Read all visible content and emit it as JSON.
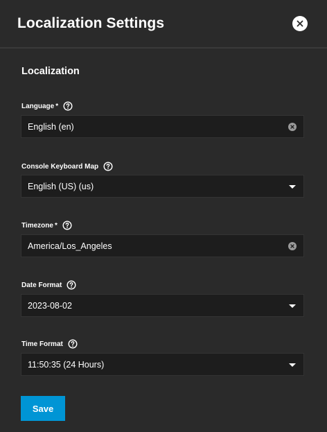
{
  "dialog": {
    "title": "Localization Settings",
    "close_icon": "close-icon"
  },
  "section": {
    "title": "Localization"
  },
  "fields": {
    "language": {
      "label": "Language",
      "required_mark": "*",
      "value": "English (en)",
      "control": "clearable-combobox"
    },
    "keyboard_map": {
      "label": "Console Keyboard Map",
      "value": "English (US) (us)",
      "control": "select"
    },
    "timezone": {
      "label": "Timezone",
      "required_mark": "*",
      "value": "America/Los_Angeles",
      "control": "clearable-combobox"
    },
    "date_format": {
      "label": "Date Format",
      "value": "2023-08-02",
      "control": "select"
    },
    "time_format": {
      "label": "Time Format",
      "value": "11:50:35 (24 Hours)",
      "control": "select"
    }
  },
  "actions": {
    "save_label": "Save"
  },
  "colors": {
    "background": "#2a2a2a",
    "field_background": "#1d1d1d",
    "primary": "#0095d5",
    "text": "#ffffff"
  }
}
